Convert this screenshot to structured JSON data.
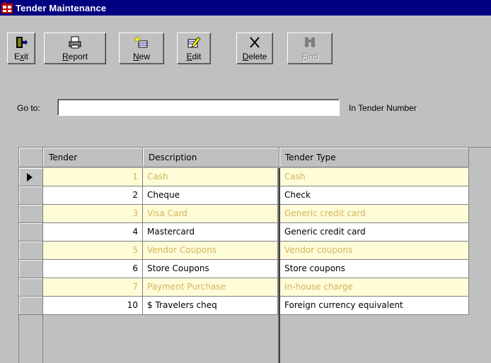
{
  "window": {
    "title": "Tender Maintenance"
  },
  "toolbar": {
    "exit": {
      "pre": "E",
      "ul": "x",
      "post": "it"
    },
    "report": {
      "pre": "",
      "ul": "R",
      "post": "eport"
    },
    "new": {
      "pre": "",
      "ul": "N",
      "post": "ew"
    },
    "edit": {
      "pre": "",
      "ul": "E",
      "post": "dit"
    },
    "delete": {
      "pre": "",
      "ul": "D",
      "post": "elete"
    },
    "find": {
      "pre": "",
      "ul": "F",
      "post": "ind",
      "enabled": false
    }
  },
  "goto": {
    "label": "Go to:",
    "value": "",
    "suffix": "In Tender Number"
  },
  "grid": {
    "columns": [
      "Tender",
      "Description",
      "Tender Type"
    ],
    "rows": [
      {
        "tender": "1",
        "description": "Cash",
        "type": "Cash"
      },
      {
        "tender": "2",
        "description": "Cheque",
        "type": "Check"
      },
      {
        "tender": "3",
        "description": "Visa Card",
        "type": "Generic credit card"
      },
      {
        "tender": "4",
        "description": "Mastercard",
        "type": "Generic credit card"
      },
      {
        "tender": "5",
        "description": "Vendor Coupons",
        "type": "Vendor coupons"
      },
      {
        "tender": "6",
        "description": "Store Coupons",
        "type": "Store coupons"
      },
      {
        "tender": "7",
        "description": "Payment Purchase",
        "type": "In-house charge"
      },
      {
        "tender": "10",
        "description": "$ Travelers cheq",
        "type": "Foreign currency equivalent"
      }
    ],
    "current_row": 0
  },
  "colors": {
    "title_bar": "#000080",
    "face": "#c0c0c0",
    "odd_row_bg": "#fffcd8",
    "odd_row_text": "#d2b45a"
  }
}
